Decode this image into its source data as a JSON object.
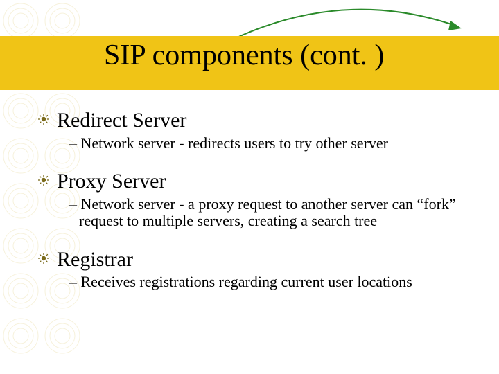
{
  "slide": {
    "title": "SIP components (cont. )",
    "items": [
      {
        "heading": "Redirect Server",
        "sub": "– Network server - redirects users to try other server"
      },
      {
        "heading": "Proxy Server",
        "sub": "– Network server - a proxy request to another server can “fork” request to multiple servers, creating a search tree"
      },
      {
        "heading": "Registrar",
        "sub": "– Receives registrations regarding current user locations"
      }
    ]
  }
}
